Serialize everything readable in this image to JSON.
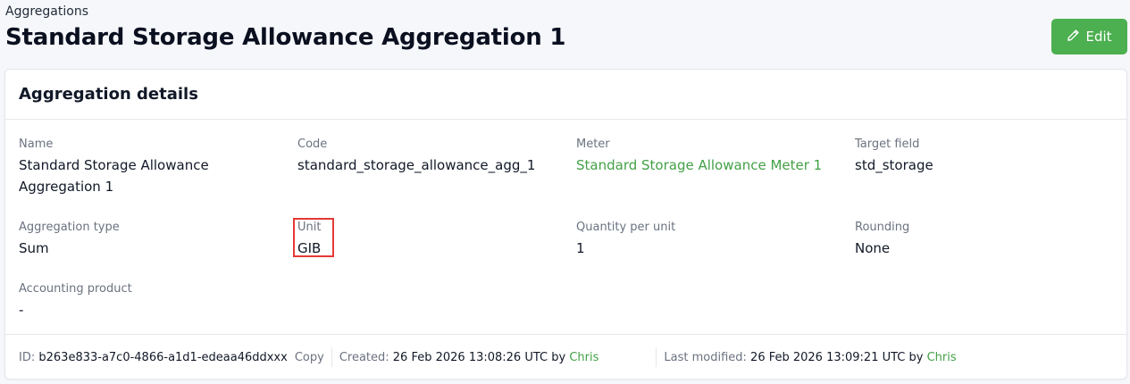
{
  "breadcrumb": "Aggregations",
  "page_title": "Standard Storage Allowance Aggregation 1",
  "edit_button": {
    "label": "Edit",
    "icon": "pencil-icon",
    "color": "#4caf50"
  },
  "card": {
    "title": "Aggregation details",
    "fields": {
      "name": {
        "label": "Name",
        "value": "Standard Storage Allowance Aggregation 1"
      },
      "code": {
        "label": "Code",
        "value": "standard_storage_allowance_agg_1"
      },
      "meter": {
        "label": "Meter",
        "value": "Standard Storage Allowance Meter 1"
      },
      "target_field": {
        "label": "Target field",
        "value": "std_storage"
      },
      "aggregation_type": {
        "label": "Aggregation type",
        "value": "Sum"
      },
      "unit": {
        "label": "Unit",
        "value": "GIB"
      },
      "quantity_per_unit": {
        "label": "Quantity per unit",
        "value": "1"
      },
      "rounding": {
        "label": "Rounding",
        "value": "None"
      },
      "accounting_product": {
        "label": "Accounting product",
        "value": "-"
      }
    },
    "footer": {
      "id_label": "ID:",
      "id_value": "b263e833-a7c0-4866-a1d1-edeaa46ddxxx",
      "copy_label": "Copy",
      "created_label": "Created:",
      "created_value": "26 Feb 2026 13:08:26 UTC by",
      "created_by": "Chris",
      "modified_label": "Last modified:",
      "modified_value": "26 Feb 2026 13:09:21 UTC by",
      "modified_by": "Chris"
    }
  },
  "colors": {
    "link": "#43a047",
    "highlight": "#e53935",
    "background": "#f5f7fa"
  }
}
